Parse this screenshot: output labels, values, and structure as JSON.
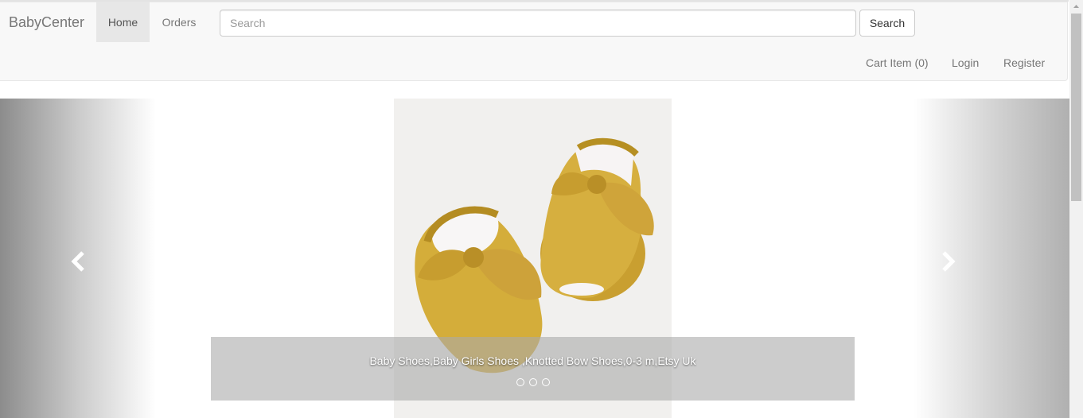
{
  "navbar": {
    "brand": "BabyCenter",
    "links": [
      "Home",
      "Orders"
    ],
    "search_placeholder": "Search",
    "search_button": "Search",
    "right_links": [
      "Cart Item (0)",
      "Login",
      "Register"
    ]
  },
  "carousel": {
    "caption": "Baby Shoes,Baby Girls Shoes ,Knotted Bow Shoes,0-3 m,Etsy Uk",
    "slide_count": 3,
    "active_slide": 1,
    "icons": {
      "prev": "chevron-left-icon",
      "next": "chevron-right-icon"
    }
  },
  "colors": {
    "navbar_bg": "#f8f8f8",
    "shoe": "#d4ad3a",
    "caption_bg": "#aaaaaa"
  }
}
